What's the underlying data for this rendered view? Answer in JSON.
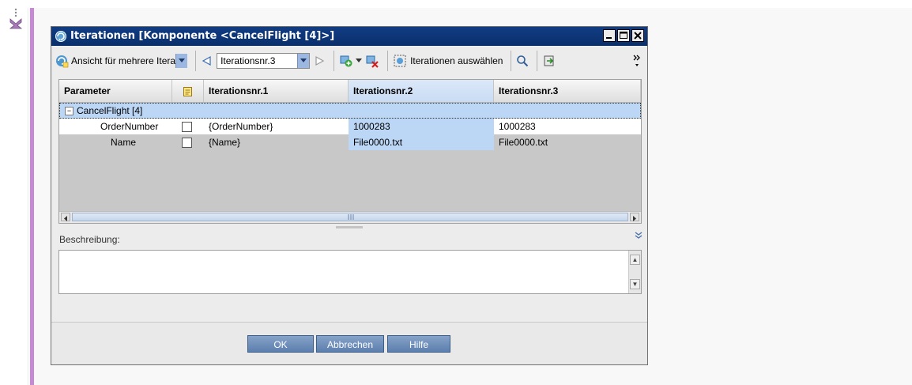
{
  "dialog": {
    "title": "Iterationen [Komponente <CancelFlight [4]>]"
  },
  "toolbar": {
    "view_combo": "Ansicht für mehrere Itera",
    "iteration_combo": "Iterationsnr.3",
    "select_iterations_label": "Iterationen auswählen"
  },
  "grid": {
    "columns": [
      "Parameter",
      "",
      "Iterationsnr.1",
      "Iterationsnr.2",
      "Iterationsnr.3"
    ],
    "group_label": "CancelFlight [4]",
    "rows": [
      {
        "parameter": "OrderNumber",
        "iter1": "{OrderNumber}",
        "iter2": "1000283",
        "iter3": "1000283"
      },
      {
        "parameter": "Name",
        "iter1": "{Name}",
        "iter2": "File0000.txt",
        "iter3": "File0000.txt"
      }
    ]
  },
  "description": {
    "label": "Beschreibung:"
  },
  "buttons": {
    "ok": "OK",
    "cancel": "Abbrechen",
    "help": "Hilfe"
  },
  "colors": {
    "title_bar": "#0a2f6b",
    "selection": "#bcd6f5",
    "grid_background": "#c8c8c8",
    "button": "#6f8fba",
    "margin_bar": "#c58ad3"
  }
}
